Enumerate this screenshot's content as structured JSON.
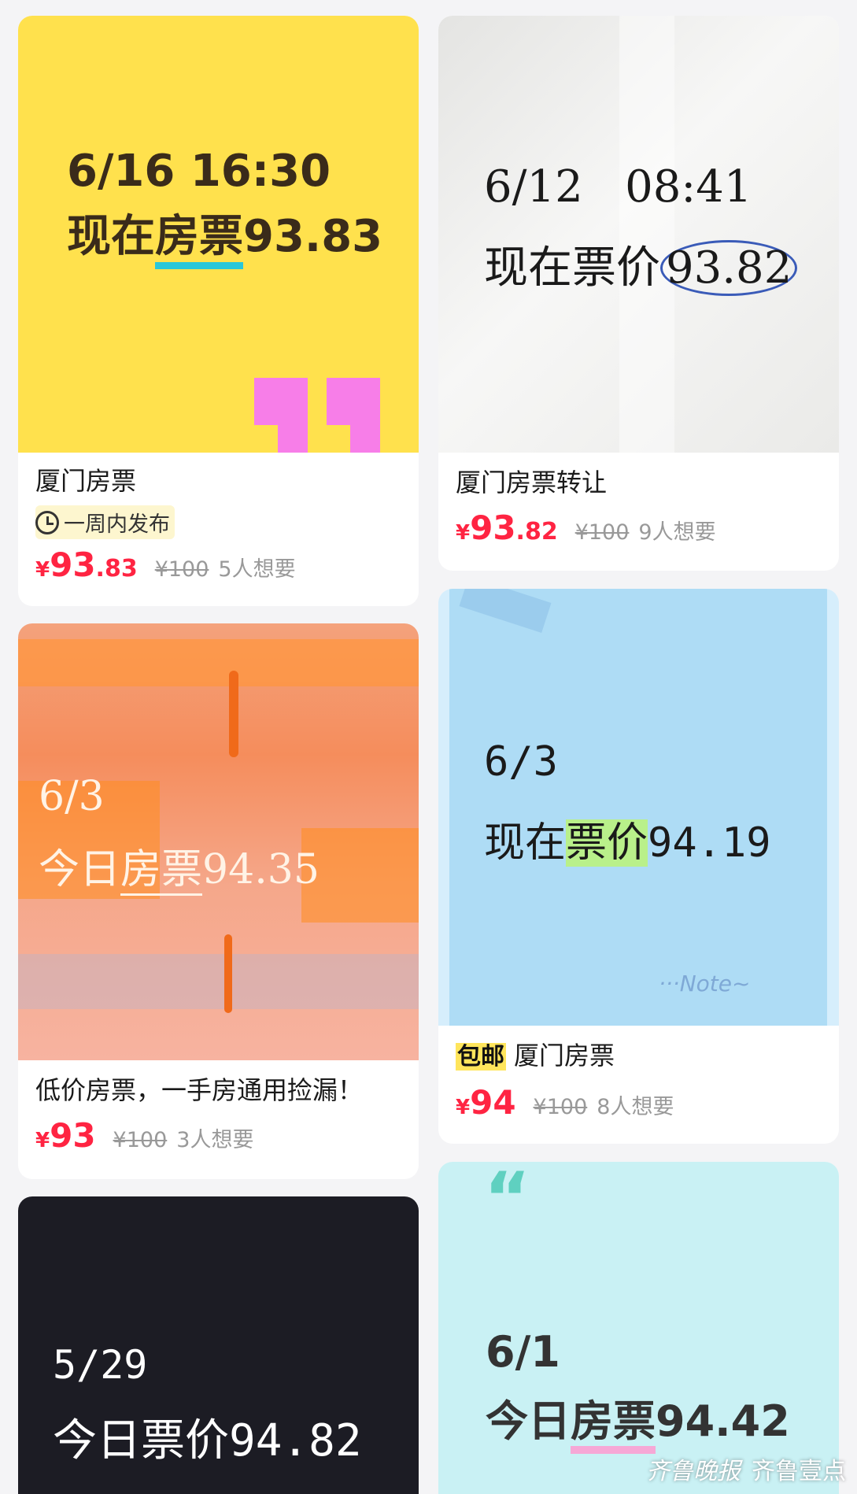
{
  "cards": [
    {
      "cover": {
        "date": "6/16 16:30",
        "prefix": "现在",
        "highlight": "房票",
        "price": "93.83",
        "bg": "#ffe14d"
      },
      "title": "厦门房票",
      "tag": "一周内发布",
      "price": {
        "yen": "¥",
        "int": "93",
        "dec": ".83",
        "orig": "¥100",
        "want": "5人想要"
      }
    },
    {
      "cover": {
        "date": "6/12   08:41",
        "prefix": "现在票价",
        "price": "93.82",
        "bg": "#eeeeec"
      },
      "title": "厦门房票转让",
      "price": {
        "yen": "¥",
        "int": "93",
        "dec": ".82",
        "orig": "¥100",
        "want": "9人想要"
      }
    },
    {
      "cover": {
        "date": "6/3",
        "prefix": "今日",
        "highlight": "房票",
        "price": "94.35",
        "bg": "#f7a07e"
      },
      "title": "低价房票，一手房通用捡漏！",
      "price": {
        "yen": "¥",
        "int": "93",
        "orig": "¥100",
        "want": "3人想要"
      }
    },
    {
      "cover": {
        "date": "6/3",
        "prefix": "现在",
        "highlight": "票价",
        "price": "94.19",
        "note": "···Note~",
        "bg": "#aedcf5"
      },
      "badge": "包邮",
      "title": "厦门房票",
      "price": {
        "yen": "¥",
        "int": "94",
        "orig": "¥100",
        "want": "8人想要"
      }
    },
    {
      "cover": {
        "date": "5/29",
        "text": "今日票价94.82",
        "bg": "#1c1c24"
      }
    },
    {
      "cover": {
        "date": "6/1",
        "prefix": "今日",
        "highlight": "房票",
        "price": "94.42",
        "bg": "#c9f1f4"
      }
    }
  ],
  "watermark": {
    "left": "齐鲁晚报",
    "right": "齐鲁壹点"
  },
  "colors": {
    "price_red": "#ff2442",
    "badge_yellow": "#ffe55c"
  }
}
